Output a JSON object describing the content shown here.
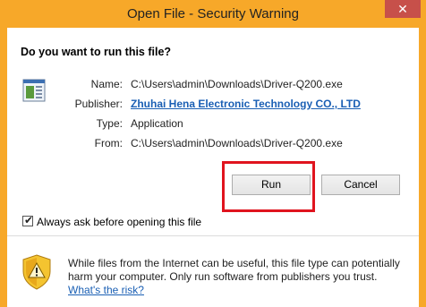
{
  "window": {
    "title": "Open File - Security Warning",
    "close_glyph": "✕"
  },
  "prompt": {
    "question": "Do you want to run this file?"
  },
  "details": {
    "name_label": "Name:",
    "name_value": "C:\\Users\\admin\\Downloads\\Driver-Q200.exe",
    "publisher_label": "Publisher:",
    "publisher_value": "Zhuhai Hena Electronic Technology CO., LTD",
    "type_label": "Type:",
    "type_value": "Application",
    "from_label": "From:",
    "from_value": "C:\\Users\\admin\\Downloads\\Driver-Q200.exe"
  },
  "buttons": {
    "run": "Run",
    "cancel": "Cancel"
  },
  "checkbox": {
    "label": "Always ask before opening this file",
    "checked": true,
    "mark": "✔"
  },
  "warning": {
    "text": "While files from the Internet can be useful, this file type can potentially harm your computer. Only run software from publishers you trust.",
    "link": "What's the risk?"
  },
  "colors": {
    "title_bar": "#f7a829",
    "highlight": "#e0141e",
    "link": "#1a5fb4"
  },
  "icons": {
    "file": "application-file-icon",
    "warning": "security-shield-icon"
  }
}
